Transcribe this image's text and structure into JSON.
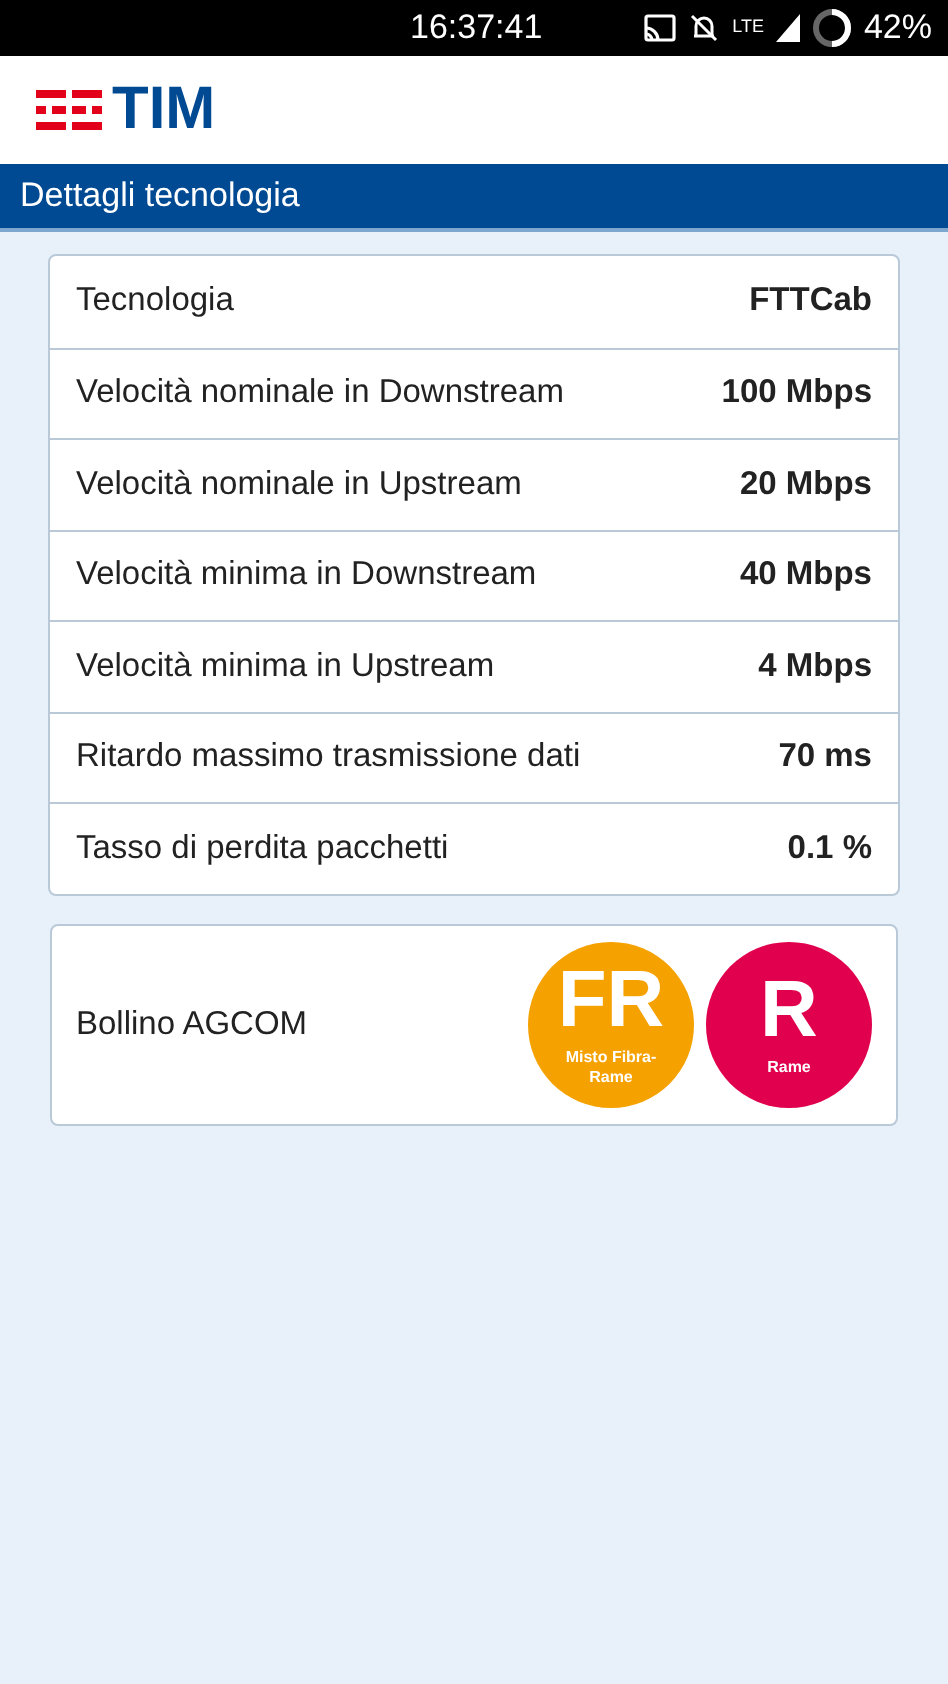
{
  "status_bar": {
    "time": "16:37:41",
    "network": "LTE",
    "battery": "42%"
  },
  "logo": {
    "text": "TIM"
  },
  "title_bar": {
    "title": "Dettagli tecnologia"
  },
  "details": [
    {
      "label": "Tecnologia",
      "value": "FTTCab"
    },
    {
      "label": "Velocità nominale in Downstream",
      "value": "100 Mbps"
    },
    {
      "label": "Velocità nominale in Upstream",
      "value": "20 Mbps"
    },
    {
      "label": "Velocità minima in Downstream",
      "value": "40 Mbps"
    },
    {
      "label": "Velocità minima in Upstream",
      "value": "4 Mbps"
    },
    {
      "label": "Ritardo massimo trasmissione dati",
      "value": "70 ms"
    },
    {
      "label": "Tasso di perdita pacchetti",
      "value": "0.1 %"
    }
  ],
  "agcom": {
    "label": "Bollino AGCOM",
    "badges": [
      {
        "letters": "FR",
        "caption": "Misto Fibra-Rame",
        "color": "#f5a100"
      },
      {
        "letters": "R",
        "caption": "Rame",
        "color": "#e0004d"
      }
    ]
  }
}
